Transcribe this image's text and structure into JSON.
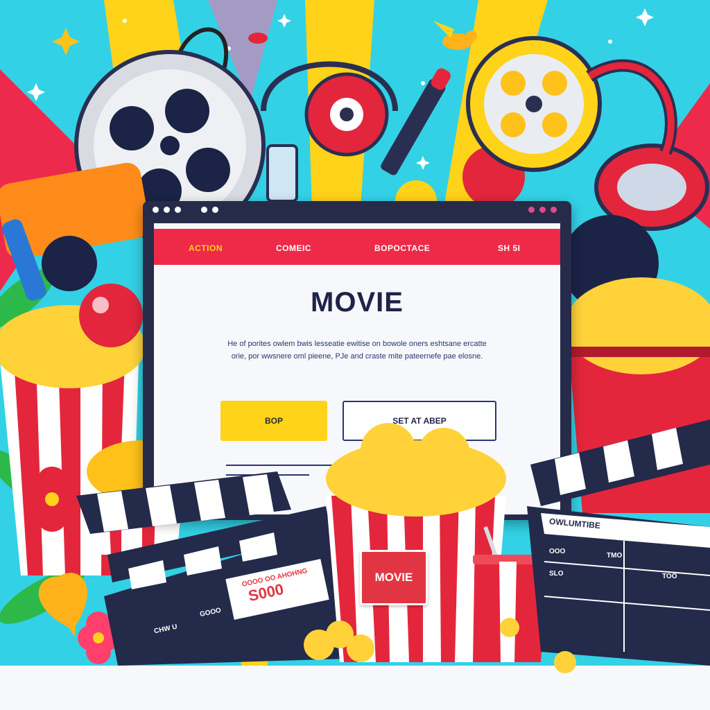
{
  "scene": {
    "description_colors": {
      "sky": "#33d1e6",
      "ray_yellow": "#ffd31a",
      "ray_red": "#ee2a4c",
      "popcorn": "#ffd23a",
      "stripe_red": "#e4263c",
      "clapper_dark": "#232a4a"
    }
  },
  "browser": {
    "title_dots": [
      "#e24a8a",
      "#e24a8a",
      "#e24a8a"
    ],
    "nav": {
      "bar_color": "#ee2a48",
      "items": [
        {
          "label": "ACTION",
          "color": "#ffd31a"
        },
        {
          "label": "COMEIC",
          "color": "#ffffff"
        },
        {
          "label": "BOPOCTACE",
          "color": "#ffffff"
        },
        {
          "label": "SH 5I",
          "color": "#ffffff"
        }
      ]
    },
    "title": "MOVIE",
    "description": [
      "He of porites owlem bwis lesseatie ewitise on bowole oners eshtsane ercatte",
      "orie, por wwsnere oml pieene, PJe and craste mite pateernefe pae elosne."
    ],
    "buttons": {
      "primary": {
        "label": "BOP",
        "color": "#ffd31a"
      },
      "secondary": {
        "label": "SET AT ABEP",
        "border": "#2a3572"
      }
    }
  },
  "props": {
    "popcorn_box_label": "MOVIE",
    "clapper_left": {
      "price": "S000",
      "line1": "OOOO OO AHOHNG",
      "line2": "CHW U",
      "line3": "GOOO"
    },
    "clapper_right": {
      "header": "OWLUMTIBE",
      "cells": [
        "OOO",
        "TMO",
        "SLO",
        "TOO"
      ]
    }
  }
}
